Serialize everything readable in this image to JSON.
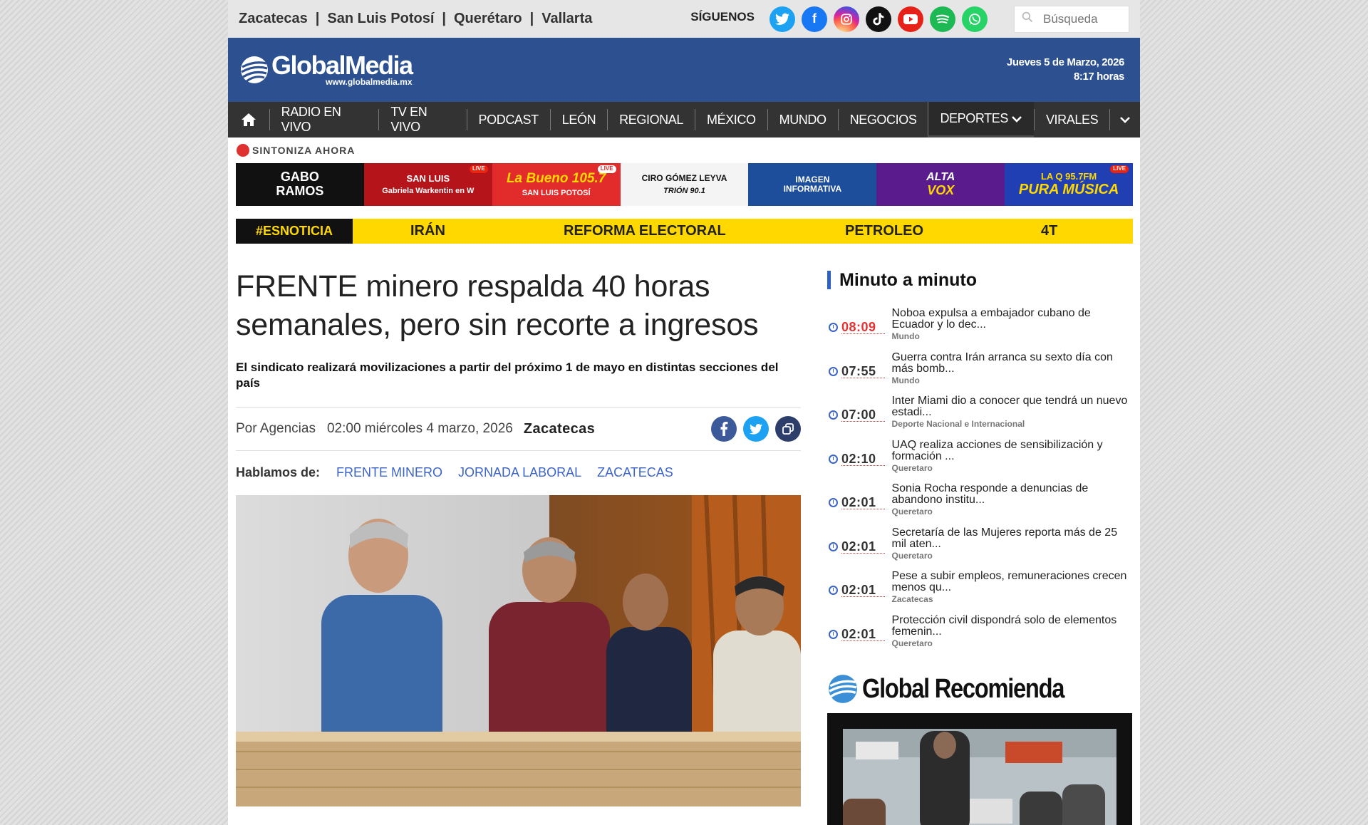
{
  "topbar": {
    "regions": [
      "Zacatecas",
      "San Luis Potosí",
      "Querétaro",
      "Vallarta"
    ],
    "follow_label": "SÍGUENOS",
    "social": [
      "twitter-icon",
      "facebook-icon",
      "instagram-icon",
      "tiktok-icon",
      "youtube-icon",
      "spotify-icon",
      "whatsapp-icon"
    ],
    "search_placeholder": "Búsqueda"
  },
  "header": {
    "logo_text": "GlobalMedia",
    "logo_url": "www.globalmedia.mx",
    "date": "Jueves 5 de Marzo, 2026",
    "time": "8:17 horas"
  },
  "nav": {
    "items": [
      "RADIO EN VIVO",
      "TV EN VIVO",
      "PODCAST",
      "LEÓN",
      "REGIONAL",
      "MÉXICO",
      "MUNDO",
      "NEGOCIOS",
      "DEPORTES",
      "VIRALES"
    ]
  },
  "live": {
    "label": "SINTONIZA AHORA",
    "stations": [
      {
        "line1": "GABO",
        "line2": "RAMOS",
        "bg": "#111111"
      },
      {
        "line1": "SAN LUIS",
        "line2": "Gabriela Warkentin en W",
        "bg": "#b4141a"
      },
      {
        "line1": "La Bueno 105.7",
        "line2": "SAN LUIS POTOSÍ",
        "bg": "#e22c2c"
      },
      {
        "line1": "CIRO GÓMEZ LEYVA",
        "line2": "TRIÓN 90.1",
        "bg": "#f4f4f4"
      },
      {
        "line1": "IMAGEN",
        "line2": "INFORMATIVA",
        "bg": "#1d4e9c"
      },
      {
        "line1": "ALTA",
        "line2": "VOX",
        "bg": "#5a1c8c"
      },
      {
        "line1": "LA Q 95.7FM",
        "line2": "PURA MÚSICA",
        "bg": "#1f3fb2"
      }
    ],
    "live_tag": "LIVE"
  },
  "trending": {
    "hashtag": "#ESNOTICIA",
    "topics": [
      "IRÁN",
      "REFORMA ELECTORAL",
      "PETROLEO",
      "4T"
    ]
  },
  "article": {
    "title": "FRENTE minero respalda 40 horas semanales, pero sin recorte a ingresos",
    "subtitle": "El sindicato realizará movilizaciones a partir del próximo 1 de mayo en distintas secciones del país",
    "author": "Por Agencias",
    "date": "02:00 miércoles 4 marzo, 2026",
    "location": "Zacatecas",
    "tags_label": "Hablamos de:",
    "tags": [
      "FRENTE MINERO",
      "JORNADA LABORAL",
      "ZACATECAS"
    ]
  },
  "sidebar": {
    "title": "Minuto a minuto",
    "items": [
      {
        "time": "08:09",
        "headline": "Noboa expulsa a embajador cubano de Ecuador y lo dec...",
        "category": "Mundo"
      },
      {
        "time": "07:55",
        "headline": "Guerra contra Irán arranca su sexto día con más bomb...",
        "category": "Mundo"
      },
      {
        "time": "07:00",
        "headline": "Inter Miami dio a conocer que tendrá un nuevo estadi...",
        "category": "Deporte Nacional e Internacional"
      },
      {
        "time": "02:10",
        "headline": "UAQ realiza acciones de sensibilización y formación ...",
        "category": "Queretaro"
      },
      {
        "time": "02:01",
        "headline": "Sonia Rocha responde a denuncias de abandono institu...",
        "category": "Queretaro"
      },
      {
        "time": "02:01",
        "headline": "Secretaría de las Mujeres reporta más de 25 mil aten...",
        "category": "Queretaro"
      },
      {
        "time": "02:01",
        "headline": "Pese a subir empleos, remuneraciones crecen menos qu...",
        "category": "Zacatecas"
      },
      {
        "time": "02:01",
        "headline": "Protección civil dispondrá solo de elementos femenin...",
        "category": "Queretaro"
      }
    ],
    "recommend_title": "Global Recomienda"
  },
  "colors": {
    "brand_blue": "#2d5190",
    "nav_dark": "#333333",
    "trend_yellow": "#ffd800",
    "link_blue": "#3c64c8",
    "alert_red": "#e53131"
  }
}
